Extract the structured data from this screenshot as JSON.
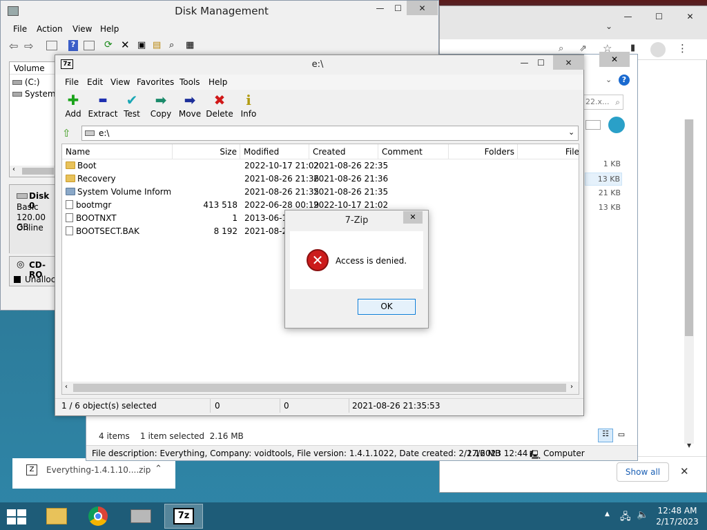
{
  "chrome_bg": {
    "right_sizes": [
      "1 KB",
      "13 KB",
      "21 KB",
      "13 KB"
    ],
    "search_fragment": "22.x...",
    "download_file": "Everything-1.4.1.10....zip",
    "show_all": "Show all"
  },
  "explorer": {
    "items_count": "4 items",
    "selected": "1 item selected  2.16 MB",
    "status_description": "File description: Everything, Company: voidtools, File version: 1.4.1.1022, Date created: 2/17/2023 12:44 /",
    "status_size": "2.16 MB",
    "status_computer": "Computer"
  },
  "diskmgmt": {
    "title": "Disk Management",
    "menu": [
      "File",
      "Action",
      "View",
      "Help"
    ],
    "volume_header": "Volume",
    "volumes": [
      "(C:)",
      "System F"
    ],
    "disk0": {
      "name": "Disk 0",
      "type": "Basic",
      "size": "120.00 GB",
      "status": "Online"
    },
    "cdrom": "CD-RO",
    "unalloc": "Unalloca"
  },
  "sevenzip": {
    "title": "e:\\",
    "menu": [
      "File",
      "Edit",
      "View",
      "Favorites",
      "Tools",
      "Help"
    ],
    "toolbar": [
      {
        "label": "Add",
        "icon": "plus-icon",
        "glyph": "✚",
        "color": "#1aa31a"
      },
      {
        "label": "Extract",
        "icon": "minus-icon",
        "glyph": "▬",
        "color": "#1d2fb0"
      },
      {
        "label": "Test",
        "icon": "check-icon",
        "glyph": "✔",
        "color": "#1aa7b5"
      },
      {
        "label": "Copy",
        "icon": "copy-arrow-icon",
        "glyph": "➡",
        "color": "#1a8a6a"
      },
      {
        "label": "Move",
        "icon": "move-arrow-icon",
        "glyph": "➡",
        "color": "#1d2f9a"
      },
      {
        "label": "Delete",
        "icon": "delete-x-icon",
        "glyph": "✖",
        "color": "#d01818"
      },
      {
        "label": "Info",
        "icon": "info-icon",
        "glyph": "i",
        "color": "#b09a10"
      }
    ],
    "address": "e:\\",
    "columns": [
      "Name",
      "Size",
      "Modified",
      "Created",
      "Comment",
      "Folders",
      "File"
    ],
    "rows": [
      {
        "name": "Boot",
        "type": "folder",
        "size": "",
        "modified": "2022-10-17 21:02",
        "created": "2021-08-26 22:35"
      },
      {
        "name": "Recovery",
        "type": "folder",
        "size": "",
        "modified": "2021-08-26 21:36",
        "created": "2021-08-26 21:36"
      },
      {
        "name": "System Volume Informa...",
        "type": "folder",
        "size": "",
        "modified": "2021-08-26 21:35",
        "created": "2021-08-26 21:35"
      },
      {
        "name": "bootmgr",
        "type": "file",
        "size": "413 518",
        "modified": "2022-06-28 00:19",
        "created": "2022-10-17 21:02"
      },
      {
        "name": "BOOTNXT",
        "type": "file",
        "size": "1",
        "modified": "2013-06-18",
        "created": ""
      },
      {
        "name": "BOOTSECT.BAK",
        "type": "file",
        "size": "8 192",
        "modified": "2021-08-26",
        "created": ""
      }
    ],
    "status": [
      "1 / 6 object(s) selected",
      "0",
      "0",
      "2021-08-26 21:35:53"
    ]
  },
  "dialog": {
    "title": "7-Zip",
    "message": "Access is denied.",
    "ok": "OK"
  },
  "taskbar": {
    "time": "12:48 AM",
    "date": "2/17/2023"
  }
}
